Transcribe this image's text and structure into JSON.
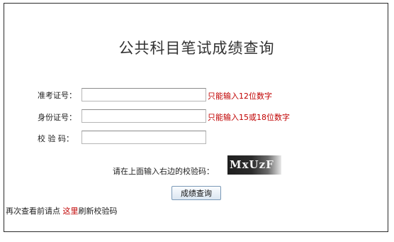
{
  "page": {
    "title": "公共科目笔试成绩查询"
  },
  "form": {
    "ticket": {
      "label": "准考证号：",
      "value": "",
      "hint": "只能输入12位数字"
    },
    "id_number": {
      "label": "身份证号：",
      "value": "",
      "hint": "只能输入15或18位数字"
    },
    "verify_code": {
      "label": "校 验 码：",
      "value": ""
    },
    "captcha_prompt": "请在上面输入右边的校验码：",
    "captcha_text": "MxUzF",
    "submit_label": "成绩查询"
  },
  "refresh": {
    "prefix": "再次查看前请点 ",
    "link": "这里",
    "suffix": "刷新校验码"
  },
  "colors": {
    "hint": "#c00000",
    "border": "#2b2b2b"
  }
}
